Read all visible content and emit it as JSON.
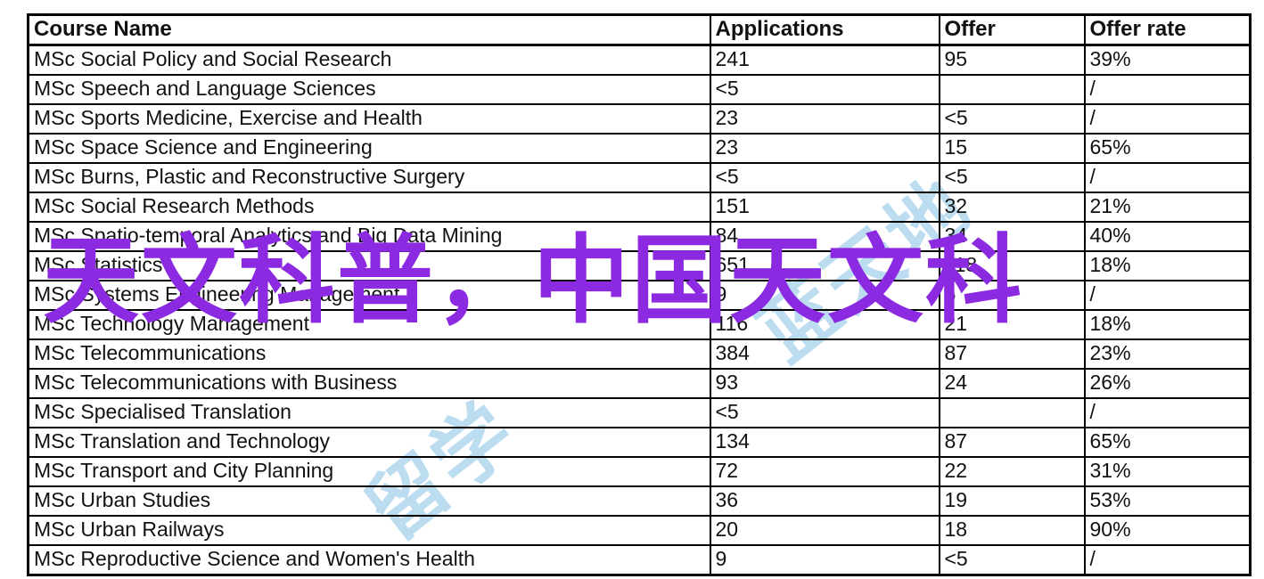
{
  "watermarks": {
    "purple_text": "天文科普，中国天文科",
    "purple_color": "#8b2ae0",
    "blue_text_a": "留学",
    "blue_text_b": "蓝天地",
    "blue_color": "#b9dcf0"
  },
  "table": {
    "columns": [
      {
        "key": "course",
        "label": "Course Name"
      },
      {
        "key": "applications",
        "label": "Applications"
      },
      {
        "key": "offer",
        "label": "Offer"
      },
      {
        "key": "offer_rate",
        "label": "Offer rate"
      }
    ],
    "rows": [
      {
        "course": "MSc Social Policy and Social Research",
        "applications": "241",
        "offer": "95",
        "offer_rate": "39%"
      },
      {
        "course": "MSc Speech and Language Sciences",
        "applications": "<5",
        "offer": "",
        "offer_rate": "/"
      },
      {
        "course": "MSc Sports Medicine, Exercise and Health",
        "applications": "23",
        "offer": "<5",
        "offer_rate": "/"
      },
      {
        "course": "MSc Space Science and Engineering",
        "applications": "23",
        "offer": "15",
        "offer_rate": "65%"
      },
      {
        "course": "MSc Burns, Plastic and Reconstructive Surgery",
        "applications": "<5",
        "offer": "<5",
        "offer_rate": "/"
      },
      {
        "course": "MSc Social Research Methods",
        "applications": "151",
        "offer": "32",
        "offer_rate": "21%"
      },
      {
        "course": "MSc Spatio-temporal Analytics and Big Data Mining",
        "applications": "84",
        "offer": "34",
        "offer_rate": "40%"
      },
      {
        "course": "MSc Statistics",
        "applications": "651",
        "offer": "118",
        "offer_rate": "18%"
      },
      {
        "course": "MSc Systems Engineering Management",
        "applications": "9",
        "offer": "5",
        "offer_rate": "/"
      },
      {
        "course": "MSc Technology Management",
        "applications": "116",
        "offer": "21",
        "offer_rate": "18%"
      },
      {
        "course": "MSc Telecommunications",
        "applications": "384",
        "offer": "87",
        "offer_rate": "23%"
      },
      {
        "course": "MSc Telecommunications with Business",
        "applications": "93",
        "offer": "24",
        "offer_rate": "26%"
      },
      {
        "course": "MSc Specialised Translation",
        "applications": "<5",
        "offer": "",
        "offer_rate": "/"
      },
      {
        "course": "MSc Translation and Technology",
        "applications": "134",
        "offer": "87",
        "offer_rate": "65%"
      },
      {
        "course": "MSc Transport and City Planning",
        "applications": "72",
        "offer": "22",
        "offer_rate": "31%"
      },
      {
        "course": "MSc Urban Studies",
        "applications": "36",
        "offer": "19",
        "offer_rate": "53%"
      },
      {
        "course": "MSc Urban Railways",
        "applications": "20",
        "offer": "18",
        "offer_rate": "90%"
      },
      {
        "course": "MSc Reproductive Science and Women's Health",
        "applications": "9",
        "offer": "<5",
        "offer_rate": "/"
      }
    ]
  }
}
